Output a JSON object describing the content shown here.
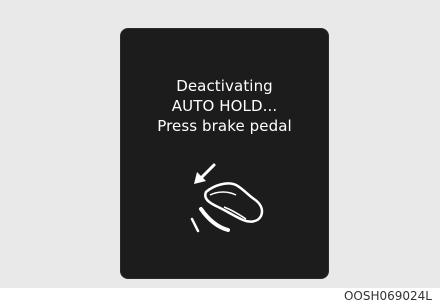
{
  "display": {
    "line1": "Deactivating",
    "line2": "AUTO HOLD...",
    "line3": "Press brake pedal"
  },
  "icon": "foot-on-brake-pedal-icon",
  "image_code": "OOSH069024L",
  "colors": {
    "background": "#e9e9e9",
    "cluster": "#1c1c1c",
    "text": "#ffffff"
  }
}
